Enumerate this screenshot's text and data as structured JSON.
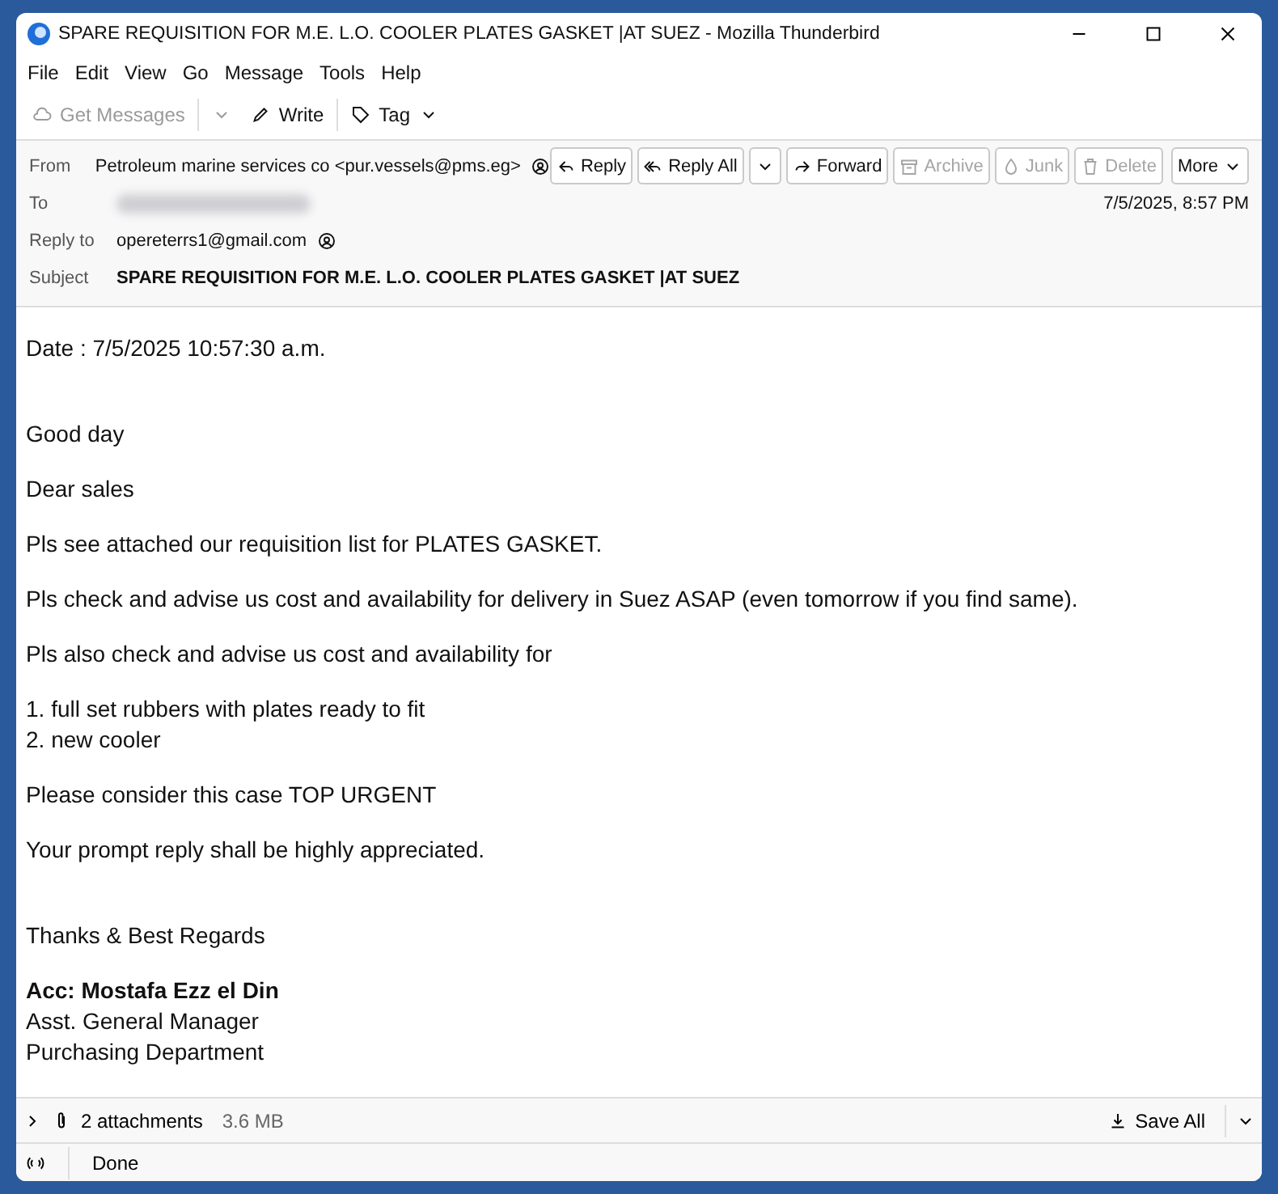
{
  "window": {
    "title": "SPARE REQUISITION FOR M.E. L.O. COOLER PLATES GASKET |AT SUEZ - Mozilla Thunderbird"
  },
  "menu": [
    "File",
    "Edit",
    "View",
    "Go",
    "Message",
    "Tools",
    "Help"
  ],
  "toolbar": [
    {
      "kind": "get",
      "label": "Get Messages",
      "disabled": true
    },
    {
      "kind": "write",
      "label": "Write",
      "disabled": false
    },
    {
      "kind": "tag",
      "label": "Tag",
      "disabled": false
    }
  ],
  "header": {
    "from_label": "From",
    "from": "Petroleum marine services co <pur.vessels@pms.eg>",
    "to_label": "To",
    "date": "7/5/2025, 8:57 PM",
    "reply_to_label": "Reply to",
    "reply_to": "opereterrs1@gmail.com",
    "subject_label": "Subject",
    "subject": "SPARE REQUISITION FOR M.E. L.O. COOLER PLATES GASKET |AT SUEZ",
    "actions": [
      {
        "kind": "reply",
        "label": "Reply",
        "disabled": false
      },
      {
        "kind": "replyall",
        "label": "Reply All",
        "disabled": false
      },
      {
        "kind": "forward",
        "label": "Forward",
        "disabled": false
      },
      {
        "kind": "archive",
        "label": "Archive",
        "disabled": true
      },
      {
        "kind": "junk",
        "label": "Junk",
        "disabled": true
      },
      {
        "kind": "delete",
        "label": "Delete",
        "disabled": true
      },
      {
        "kind": "more",
        "label": "More",
        "disabled": false
      }
    ]
  },
  "body": {
    "sections": [
      [
        {
          "lines": [
            {
              "text": "Date : 7/5/2025 10:57:30 a.m.",
              "bold": false
            }
          ]
        }
      ],
      [
        {
          "lines": [
            {
              "text": "Good day",
              "bold": false
            }
          ]
        },
        {
          "lines": [
            {
              "text": "Dear sales",
              "bold": false
            }
          ]
        },
        {
          "lines": [
            {
              "text": "Pls see attached our requisition list for PLATES GASKET.",
              "bold": false
            }
          ]
        },
        {
          "lines": [
            {
              "text": "Pls check and advise us cost and availability for delivery in Suez ASAP (even tomorrow if you find same).",
              "bold": false
            }
          ]
        },
        {
          "lines": [
            {
              "text": "Pls also check and advise us cost and availability for",
              "bold": false
            }
          ]
        },
        {
          "lines": [
            {
              "text": "1. full set rubbers with plates ready to fit",
              "bold": false
            },
            {
              "text": "2. new cooler",
              "bold": false
            }
          ]
        },
        {
          "lines": [
            {
              "text": "Please consider this case TOP URGENT",
              "bold": false
            }
          ]
        },
        {
          "lines": [
            {
              "text": "Your prompt reply shall be highly appreciated.",
              "bold": false
            }
          ]
        }
      ],
      [
        {
          "lines": [
            {
              "text": "Thanks & Best Regards",
              "bold": false
            }
          ]
        },
        {
          "lines": [
            {
              "text": "Acc: Mostafa Ezz el Din",
              "bold": true
            },
            {
              "text": "Asst. General Manager",
              "bold": false
            },
            {
              "text": "Purchasing Department",
              "bold": false
            }
          ]
        }
      ]
    ]
  },
  "attachments": {
    "count": "2 attachments",
    "size": "3.6 MB",
    "save_all": "Save All",
    "expanded": false
  },
  "status_bar": {
    "text": "Done"
  }
}
